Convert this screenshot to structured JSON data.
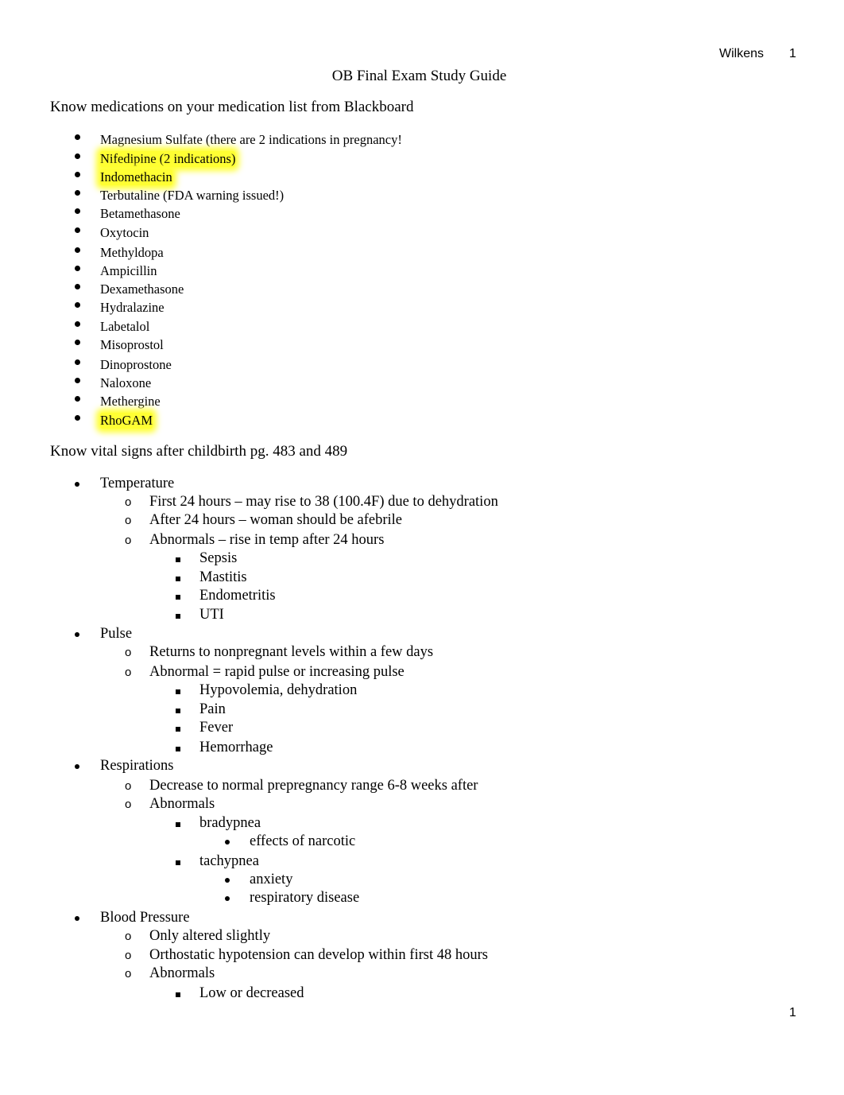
{
  "header": {
    "author": "Wilkens",
    "page_number": "1"
  },
  "footer": {
    "page_number": "1"
  },
  "title": "OB Final Exam Study Guide",
  "medications_section": {
    "heading": "Know medications on your medication list from Blackboard",
    "items": [
      {
        "text": "Magnesium Sulfate (there are 2 indications in pregnancy!",
        "highlighted": false
      },
      {
        "text": "Nifedipine (2 indications)",
        "highlighted": true
      },
      {
        "text": "Indomethacin",
        "highlighted": true
      },
      {
        "text": "Terbutaline (FDA warning issued!)",
        "highlighted": false
      },
      {
        "text": "Betamethasone",
        "highlighted": false
      },
      {
        "text": "Oxytocin",
        "highlighted": false
      },
      {
        "text": "Methyldopa",
        "highlighted": false
      },
      {
        "text": "Ampicillin",
        "highlighted": false
      },
      {
        "text": "Dexamethasone",
        "highlighted": false
      },
      {
        "text": "Hydralazine",
        "highlighted": false
      },
      {
        "text": "Labetalol",
        "highlighted": false
      },
      {
        "text": "Misoprostol",
        "highlighted": false
      },
      {
        "text": "Dinoprostone",
        "highlighted": false
      },
      {
        "text": "Naloxone",
        "highlighted": false
      },
      {
        "text": "Methergine",
        "highlighted": false
      },
      {
        "text": "RhoGAM",
        "highlighted": true
      }
    ],
    "highlight_color": "#ffff33"
  },
  "vitals_section": {
    "heading": "Know vital signs after childbirth pg. 483 and 489",
    "items": [
      {
        "level": 1,
        "text": "Temperature"
      },
      {
        "level": 2,
        "text": "First 24 hours – may rise to 38 (100.4F) due to dehydration"
      },
      {
        "level": 2,
        "text": "After 24 hours – woman should be afebrile"
      },
      {
        "level": 2,
        "text": "Abnormals – rise in temp after 24 hours"
      },
      {
        "level": 3,
        "text": "Sepsis"
      },
      {
        "level": 3,
        "text": "Mastitis"
      },
      {
        "level": 3,
        "text": "Endometritis"
      },
      {
        "level": 3,
        "text": "UTI"
      },
      {
        "level": 1,
        "text": "Pulse"
      },
      {
        "level": 2,
        "text": "Returns to nonpregnant levels within a few days"
      },
      {
        "level": 2,
        "text": "Abnormal = rapid pulse or increasing pulse"
      },
      {
        "level": 3,
        "text": "Hypovolemia, dehydration"
      },
      {
        "level": 3,
        "text": "Pain"
      },
      {
        "level": 3,
        "text": "Fever"
      },
      {
        "level": 3,
        "text": "Hemorrhage"
      },
      {
        "level": 1,
        "text": "Respirations"
      },
      {
        "level": 2,
        "text": "Decrease to normal prepregnancy range 6-8 weeks after"
      },
      {
        "level": 2,
        "text": "Abnormals"
      },
      {
        "level": 3,
        "text": "bradypnea"
      },
      {
        "level": 4,
        "text": "effects of narcotic"
      },
      {
        "level": 3,
        "text": "tachypnea"
      },
      {
        "level": 4,
        "text": "anxiety"
      },
      {
        "level": 4,
        "text": "respiratory disease"
      },
      {
        "level": 1,
        "text": "Blood Pressure"
      },
      {
        "level": 2,
        "text": "Only altered slightly"
      },
      {
        "level": 2,
        "text": "Orthostatic hypotension can develop within first 48 hours"
      },
      {
        "level": 2,
        "text": "Abnormals"
      },
      {
        "level": 3,
        "text": "Low or decreased"
      }
    ]
  }
}
